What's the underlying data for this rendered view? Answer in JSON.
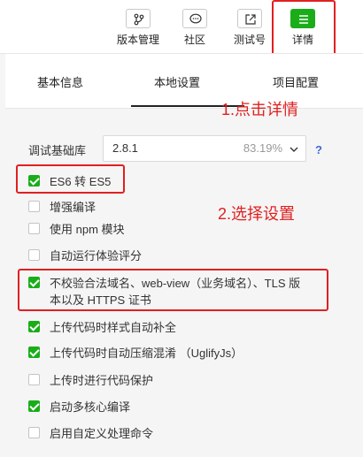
{
  "toolbar": {
    "version_label": "版本管理",
    "community_label": "社区",
    "test_label": "测试号",
    "details_label": "详情"
  },
  "tabs": {
    "basic": "基本信息",
    "local": "本地设置",
    "project": "项目配置"
  },
  "annotations": {
    "step1": "1.点击详情",
    "step2": "2.选择设置"
  },
  "debug_lib": {
    "label": "调试基础库",
    "version": "2.8.1",
    "percent": "83.19%",
    "help": "?"
  },
  "options": [
    {
      "label": "ES6 转 ES5",
      "checked": true
    },
    {
      "label": "增强编译",
      "checked": false
    },
    {
      "label": "使用 npm 模块",
      "checked": false
    },
    {
      "label": "自动运行体验评分",
      "checked": false
    },
    {
      "label_line1": "不校验合法域名、web-view（业务域名）、TLS 版",
      "label_line2": "本以及 HTTPS 证书",
      "checked": true
    },
    {
      "label": "上传代码时样式自动补全",
      "checked": true
    },
    {
      "label": "上传代码时自动压缩混淆 （UglifyJs）",
      "checked": true
    },
    {
      "label": "上传时进行代码保护",
      "checked": false
    },
    {
      "label": "启动多核心编译",
      "checked": true
    },
    {
      "label": "启用自定义处理命令",
      "checked": false
    }
  ],
  "colors": {
    "accent_green": "#1aad19",
    "annotation_red": "#e02020",
    "help_blue": "#3e6bd2"
  }
}
